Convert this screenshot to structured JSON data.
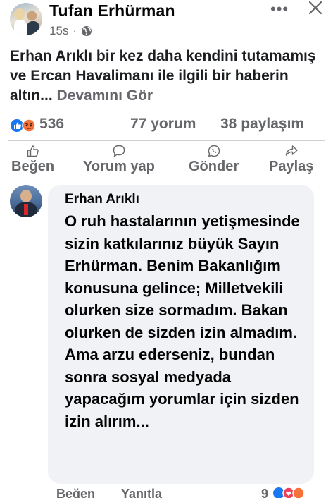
{
  "post": {
    "author": "Tufan Erhürman",
    "time": "15s",
    "separator": "·",
    "more": "•••",
    "text": "Erhan Arıklı bir kez daha kendini tutamamış ve Ercan Havalimanı ile ilgili bir haberin altın...",
    "see_more": "Devamını Gör"
  },
  "stats": {
    "reactions": "536",
    "comments": "77 yorum",
    "shares": "38 paylaşım"
  },
  "actions": {
    "like": "Beğen",
    "comment": "Yorum yap",
    "send": "Gönder",
    "share": "Paylaş"
  },
  "comment": {
    "author": "Erhan Arıklı",
    "text": "O ruh hastalarının yetişmesinde sizin katkılarınız büyük Sayın Erhürman. Benim Bakanlığım konusuna gelince; Milletvekili olurken size sormadım. Bakan olurken de sizden izin almadım. Ama arzu ederseniz, bundan sonra sosyal medyada yapacağım yorumlar için sizden izin alırım...",
    "footer_like": "Beğen",
    "footer_reply": "Yanıtla",
    "reaction_count": "9"
  },
  "colors": {
    "like_blue": "#1877f2",
    "angry_orange": "#f7713a",
    "love_red": "#f33e58",
    "muted_text": "#65676b",
    "bubble_bg": "#f0f2f5"
  },
  "icons": [
    "globe-icon",
    "more-icon",
    "close-icon",
    "like-reaction-icon",
    "angry-reaction-icon",
    "like-icon",
    "comment-icon",
    "whatsapp-icon",
    "share-icon",
    "love-reaction-icon"
  ]
}
